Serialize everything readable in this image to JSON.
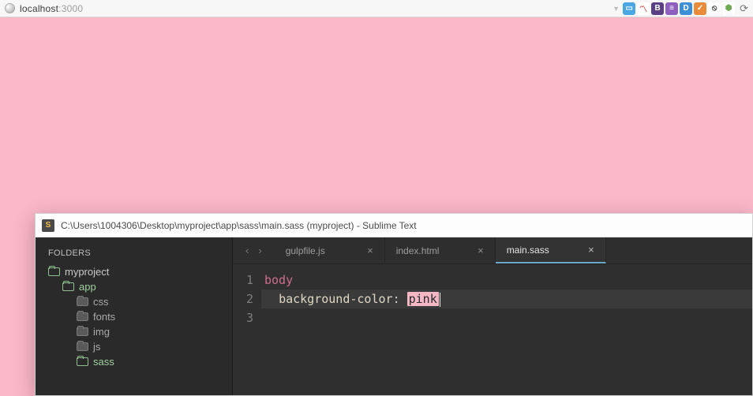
{
  "browser": {
    "host": "localhost",
    "port": ":3000",
    "extensions": [
      {
        "label": "",
        "bg": "#4aa7e3",
        "icon": "window-icon"
      },
      {
        "label": "",
        "bg": "#ffffff",
        "icon": "chart-icon",
        "fg": "#d24a4a"
      },
      {
        "label": "B",
        "bg": "#5a3f87"
      },
      {
        "label": "",
        "bg": "#8e5fbf",
        "icon": "bars-icon"
      },
      {
        "label": "D",
        "bg": "#3d8fd6"
      },
      {
        "label": "✓",
        "bg": "#e88b3a"
      },
      {
        "label": "⦸",
        "bg": "#ffffff",
        "fg": "#3a3a3a"
      },
      {
        "label": "⬢",
        "bg": "#ffffff",
        "fg": "#6fa84f"
      }
    ]
  },
  "sublime": {
    "title": "C:\\Users\\1004306\\Desktop\\myproject\\app\\sass\\main.sass (myproject) - Sublime Text",
    "sidebar_header": "FOLDERS",
    "tree": [
      {
        "name": "myproject",
        "type": "open",
        "level": 0
      },
      {
        "name": "app",
        "type": "open",
        "level": 1
      },
      {
        "name": "css",
        "type": "closed",
        "level": 2
      },
      {
        "name": "fonts",
        "type": "closed",
        "level": 2
      },
      {
        "name": "img",
        "type": "closed",
        "level": 2
      },
      {
        "name": "js",
        "type": "closed",
        "level": 2
      },
      {
        "name": "sass",
        "type": "open",
        "level": 2
      }
    ],
    "tabs": [
      {
        "label": "gulpfile.js",
        "active": false
      },
      {
        "label": "index.html",
        "active": false
      },
      {
        "label": "main.sass",
        "active": true
      }
    ],
    "code": {
      "line1_selector": "body",
      "line2_prop": "background-color",
      "line2_punct": ":",
      "line2_value": "pink",
      "gutter": [
        "1",
        "2",
        "3"
      ]
    }
  }
}
